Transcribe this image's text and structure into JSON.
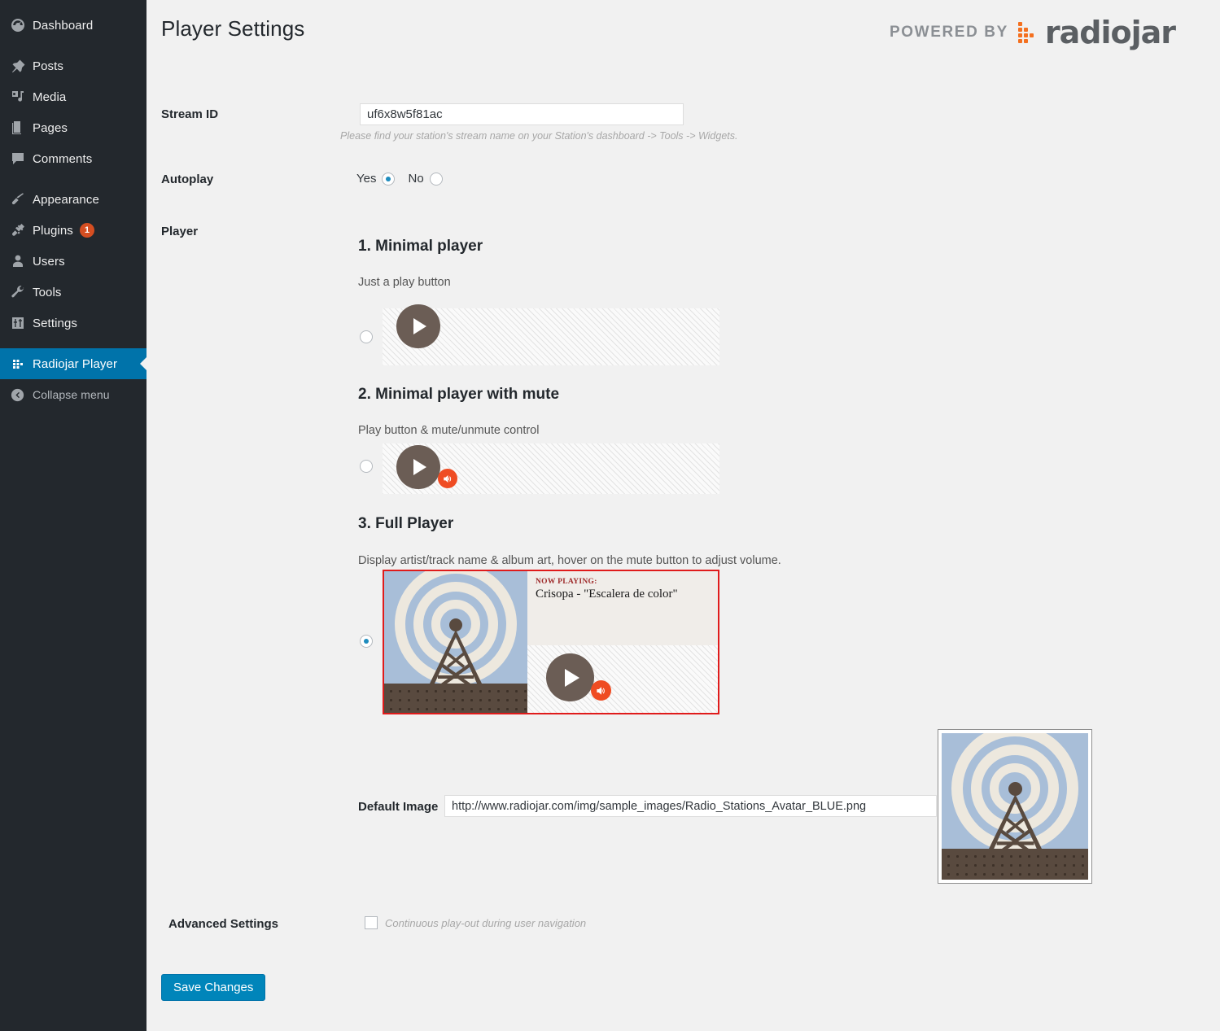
{
  "sidebar": {
    "items": [
      {
        "label": "Dashboard",
        "icon": "dashboard-icon",
        "name": "dashboard"
      },
      {
        "label": "Posts",
        "icon": "pin-icon",
        "name": "posts"
      },
      {
        "label": "Media",
        "icon": "media-icon",
        "name": "media"
      },
      {
        "label": "Pages",
        "icon": "pages-icon",
        "name": "pages"
      },
      {
        "label": "Comments",
        "icon": "comment-icon",
        "name": "comments"
      },
      {
        "label": "Appearance",
        "icon": "brush-icon",
        "name": "appearance"
      },
      {
        "label": "Plugins",
        "icon": "plug-icon",
        "name": "plugins",
        "badge": "1"
      },
      {
        "label": "Users",
        "icon": "user-icon",
        "name": "users"
      },
      {
        "label": "Tools",
        "icon": "wrench-icon",
        "name": "tools"
      },
      {
        "label": "Settings",
        "icon": "sliders-icon",
        "name": "settings"
      },
      {
        "label": "Radiojar Player",
        "icon": "radiojar-dots-icon",
        "name": "radiojar-player",
        "current": true
      }
    ],
    "collapse_label": "Collapse menu",
    "collapse_icon": "chevron-left-circle-icon",
    "badge_color": "#d54e21",
    "active_color": "#0073aa"
  },
  "header": {
    "title": "Player Settings",
    "powered_by": "POWERED BY",
    "brand_name": "radiojar",
    "brand_accent": "#f4701f"
  },
  "form": {
    "stream_id": {
      "label": "Stream ID",
      "value": "uf6x8w5f81ac",
      "placeholder": "",
      "help": "Please find your station's stream name on your Station's dashboard -> Tools -> Widgets."
    },
    "autoplay": {
      "label": "Autoplay",
      "options": [
        {
          "label": "Yes",
          "selected": true
        },
        {
          "label": "No",
          "selected": false
        }
      ]
    },
    "player": {
      "label": "Player",
      "options": [
        {
          "title": "1. Minimal player",
          "description": "Just a play button",
          "selected": false
        },
        {
          "title": "2. Minimal player with mute",
          "description": "Play button & mute/unmute control",
          "selected": false
        },
        {
          "title": "3. Full Player",
          "description": "Display artist/track name & album art, hover on the mute button to adjust volume.",
          "selected": true,
          "now_playing_label": "NOW PLAYING:",
          "now_playing_track": "Crisopa - \"Escalera de color\""
        }
      ]
    },
    "default_image": {
      "label": "Default Image",
      "value": "http://www.radiojar.com/img/sample_images/Radio_Stations_Avatar_BLUE.png",
      "placeholder": ""
    },
    "advanced": {
      "label": "Advanced Settings",
      "checkbox_label": "Continuous play-out during user navigation",
      "checked": false
    },
    "save_label": "Save Changes"
  },
  "colors": {
    "accent_blue": "#0085ba",
    "mute_orange": "#ef4c23",
    "play_brown": "#6b5d55",
    "selection_red": "#e01b1b",
    "sky_blue": "#a8bed8",
    "ring_cream": "#ede8de",
    "ground_brown": "#594a3f"
  }
}
